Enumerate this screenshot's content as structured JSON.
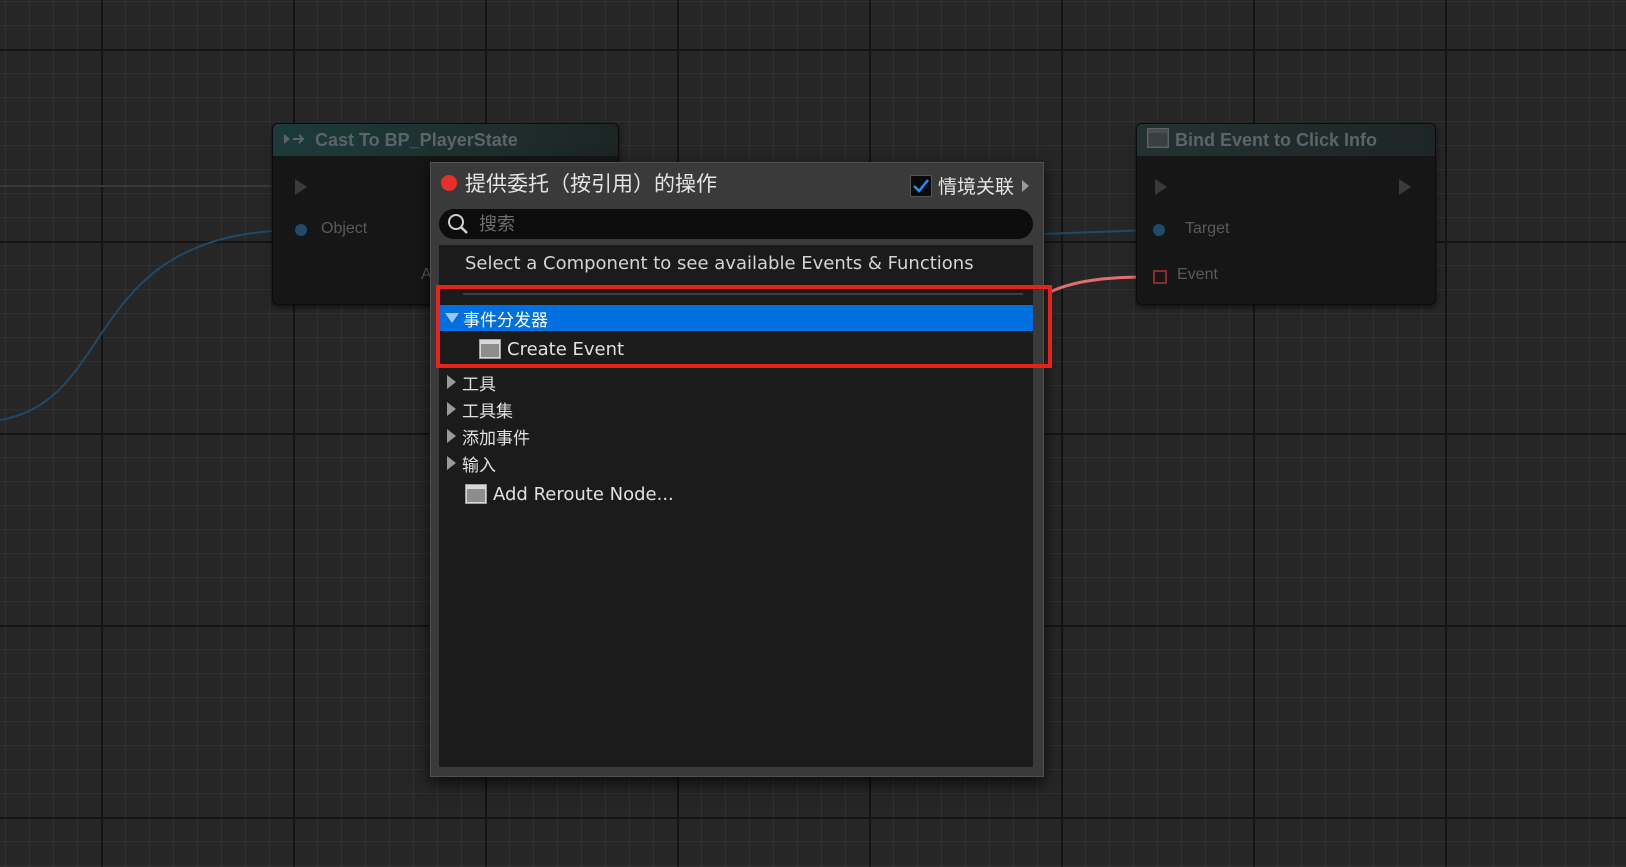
{
  "graph": {
    "cast_node": {
      "title": "Cast To BP_PlayerState",
      "pin_object": "Object",
      "pin_partial": "A"
    },
    "bind_node": {
      "title": "Bind Event to Click Info",
      "pin_target": "Target",
      "pin_event": "Event"
    },
    "wire_colors": {
      "object": "#1f4a6a",
      "event": "#e07070"
    }
  },
  "popup": {
    "title": "提供委托（按引用）的操作",
    "context_sensitive_label": "情境关联",
    "context_sensitive_checked": true,
    "search": {
      "placeholder": "搜索",
      "value": ""
    },
    "hint": "Select a Component to see available Events & Functions",
    "categories": [
      {
        "label": "事件分发器",
        "expanded": true,
        "selected": true
      },
      {
        "label": "工具",
        "expanded": false
      },
      {
        "label": "工具集",
        "expanded": false
      },
      {
        "label": "添加事件",
        "expanded": false
      },
      {
        "label": "输入",
        "expanded": false
      }
    ],
    "items": {
      "create_event": "Create Event",
      "add_reroute": "Add Reroute Node..."
    },
    "accent_color": "#0070e0",
    "highlight_color": "#e8211b"
  }
}
